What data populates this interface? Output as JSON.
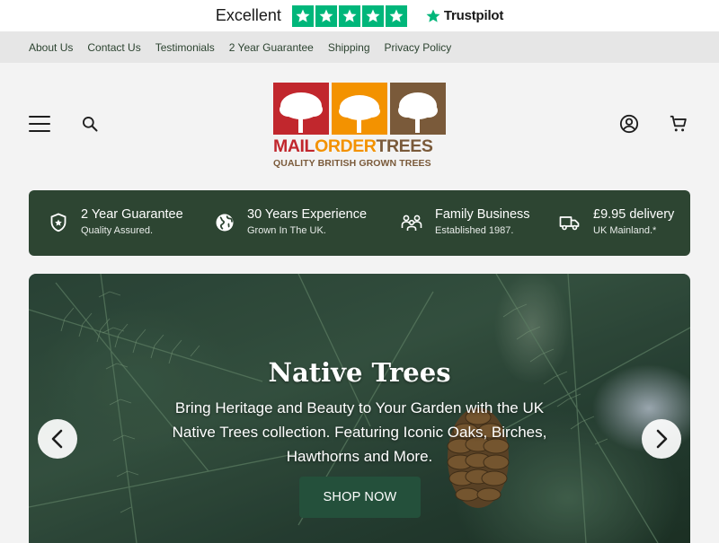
{
  "trustpilot": {
    "rating_label": "Excellent",
    "brand": "Trustpilot",
    "stars": 5,
    "star_color": "#00b67a"
  },
  "util_nav": [
    "About Us",
    "Contact Us",
    "Testimonials",
    "2 Year Guarantee",
    "Shipping",
    "Privacy Policy"
  ],
  "header": {
    "logo": {
      "word_mail": "MAIL",
      "word_order": "ORDER",
      "word_trees": "TREES",
      "tagline": "QUALITY BRITISH GROWN TREES",
      "colors": {
        "red": "#c1272d",
        "orange": "#f39200",
        "brown": "#7a5a3a"
      }
    },
    "icons": [
      "menu-icon",
      "search-icon",
      "account-icon",
      "cart-icon"
    ]
  },
  "usp": [
    {
      "icon": "shield-icon",
      "title": "2 Year Guarantee",
      "subtitle": "Quality Assured."
    },
    {
      "icon": "globe-icon",
      "title": "30 Years Experience",
      "subtitle": "Grown In The UK."
    },
    {
      "icon": "family-icon",
      "title": "Family Business",
      "subtitle": "Established 1987."
    },
    {
      "icon": "truck-icon",
      "title": "£9.95 delivery",
      "subtitle": "UK Mainland.*"
    }
  ],
  "hero": {
    "title": "Native Trees",
    "text": "Bring Heritage and Beauty to Your Garden with the UK Native Trees collection. Featuring Iconic Oaks, Birches, Hawthorns and More.",
    "button_label": "SHOP NOW",
    "accent": "#24503b"
  }
}
